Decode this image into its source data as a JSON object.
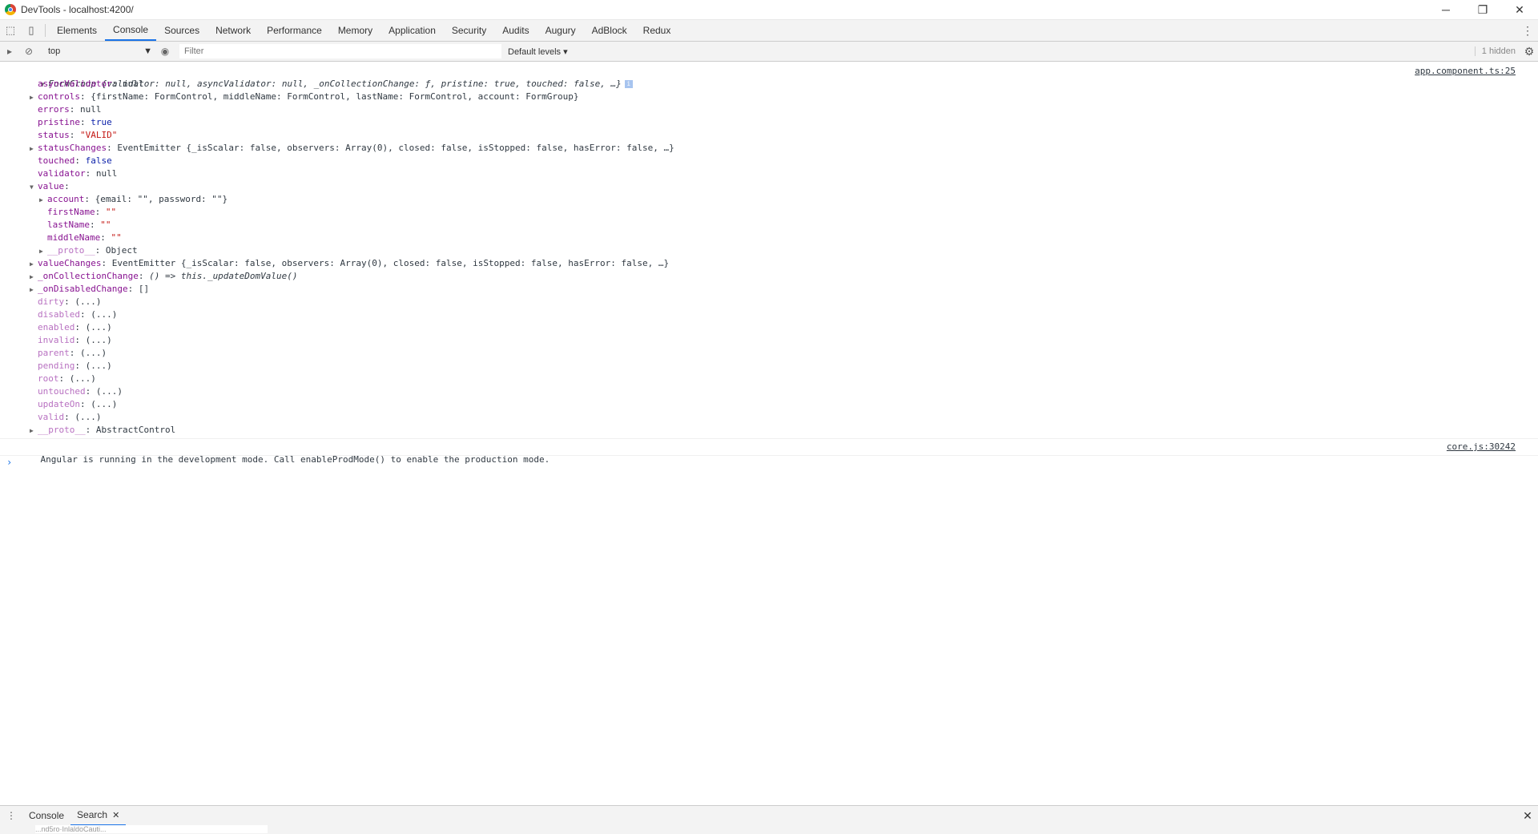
{
  "window": {
    "title": "DevTools - localhost:4200/",
    "minimize": "─",
    "restore": "❐",
    "close": "✕"
  },
  "tabs": [
    "Elements",
    "Console",
    "Sources",
    "Network",
    "Performance",
    "Memory",
    "Application",
    "Security",
    "Audits",
    "Augury",
    "AdBlock",
    "Redux"
  ],
  "active_tab": "Console",
  "toolbar": {
    "context": "top",
    "filter_placeholder": "Filter",
    "levels": "Default levels ▾",
    "hidden": "1 hidden"
  },
  "log": {
    "source1": "app.component.ts:25",
    "summary_prefix": "FormGroup ",
    "summary": "{validator: null, asyncValidator: null, _onCollectionChange: ƒ, pristine: true, touched: false, …}",
    "props": {
      "asyncValidator": "asyncValidator",
      "asyncValidator_val": "null",
      "controls": "controls",
      "controls_val": "{firstName: FormControl, middleName: FormControl, lastName: FormControl, account: FormGroup}",
      "errors": "errors",
      "errors_val": "null",
      "pristine": "pristine",
      "pristine_val": "true",
      "status": "status",
      "status_val": "\"VALID\"",
      "statusChanges": "statusChanges",
      "statusChanges_val": "EventEmitter {_isScalar: false, observers: Array(0), closed: false, isStopped: false, hasError: false, …}",
      "touched": "touched",
      "touched_val": "false",
      "validator": "validator",
      "validator_val": "null",
      "value": "value",
      "account": "account",
      "account_val": "{email: \"\", password: \"\"}",
      "firstName": "firstName",
      "firstName_val": "\"\"",
      "lastName": "lastName",
      "lastName_val": "\"\"",
      "middleName": "middleName",
      "middleName_val": "\"\"",
      "proto1": "__proto__",
      "proto1_val": "Object",
      "valueChanges": "valueChanges",
      "valueChanges_val": "EventEmitter {_isScalar: false, observers: Array(0), closed: false, isStopped: false, hasError: false, …}",
      "onCollectionChange": "_onCollectionChange",
      "onCollectionChange_val": "() => this._updateDomValue()",
      "onDisabledChange": "_onDisabledChange",
      "onDisabledChange_val": "[]",
      "getters": [
        "dirty",
        "disabled",
        "enabled",
        "invalid",
        "parent",
        "pending",
        "root",
        "untouched",
        "updateOn",
        "valid"
      ],
      "getter_val": "(...)",
      "proto2": "__proto__",
      "proto2_val": "AbstractControl"
    },
    "message2": "Angular is running in the development mode. Call enableProdMode() to enable the production mode.",
    "source2": "core.js:30242"
  },
  "drawer": {
    "tabs": [
      "Console",
      "Search"
    ],
    "active": "Search",
    "input_text": "...nd5ro·InlaldoCauti..."
  }
}
